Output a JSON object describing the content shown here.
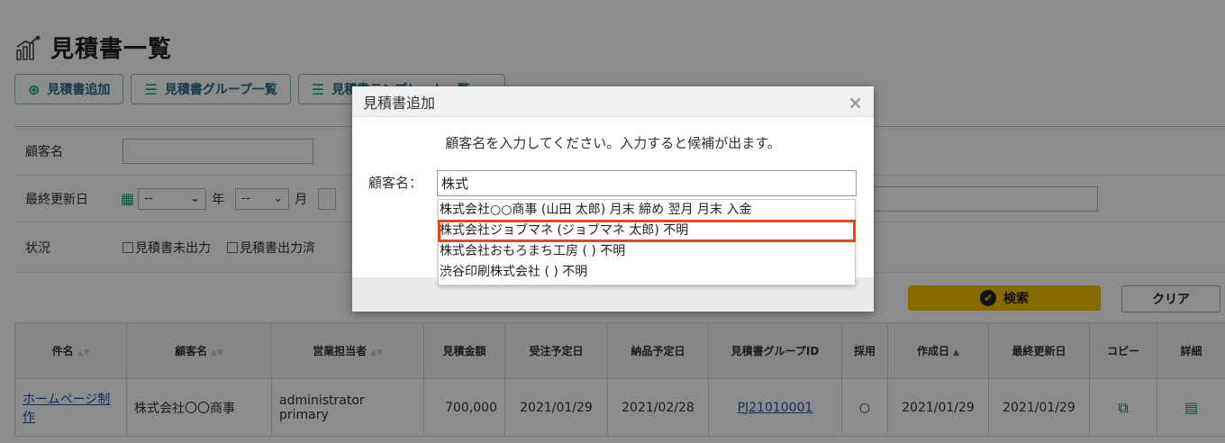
{
  "page": {
    "title": "見積書一覧",
    "title_icon": "chart-growth-icon"
  },
  "toolbar": [
    {
      "label": "見積書追加",
      "icon": "plus-circle-icon"
    },
    {
      "label": "見積書グループ一覧",
      "icon": "list-icon"
    },
    {
      "label": "見積書テンプレート一覧",
      "icon": "list-icon"
    }
  ],
  "filter": {
    "customer_label": "顧客名",
    "customer_value": "",
    "updated_label": "最終更新日",
    "year_select": "--",
    "year_unit": "年",
    "month_select": "--",
    "month_unit": "月",
    "status_label": "状況",
    "status_options": [
      "見積書未出力",
      "見積書出力済"
    ],
    "search_label": "検索",
    "clear_label": "クリア"
  },
  "table": {
    "headers": [
      "件名",
      "顧客名",
      "営業担当者",
      "見積金額",
      "受注予定日",
      "納品予定日",
      "見積書グループID",
      "採用",
      "作成日",
      "最終更新日",
      "コピー",
      "詳細"
    ],
    "rows": [
      {
        "subject": "ホームページ制作",
        "customer": "株式会社〇〇商事",
        "sales": "administrator primary",
        "amount": "700,000",
        "order_date": "2021/01/29",
        "delivery_date": "2021/02/28",
        "group_id": "PJ21010001",
        "adopted": "○",
        "created": "2021/01/29",
        "updated": "2021/01/29"
      }
    ]
  },
  "modal": {
    "title": "見積書追加",
    "message": "顧客名を入力してください。入力すると候補が出ます。",
    "field_label": "顧客名：",
    "input_value": "株式",
    "suggestions": [
      "株式会社○○商事 (山田 太郎) 月末 締め 翌月 月末 入金",
      "株式会社ジョブマネ (ジョブマネ 太郎) 不明",
      "株式会社おもろまち工房 ( ) 不明",
      "渋谷印刷株式会社 ( ) 不明"
    ],
    "highlighted_index": 1,
    "close_glyph": "×"
  },
  "colors": {
    "accent": "#2a6e86",
    "search_button": "#f2c200",
    "highlight": "#e04a1a"
  }
}
